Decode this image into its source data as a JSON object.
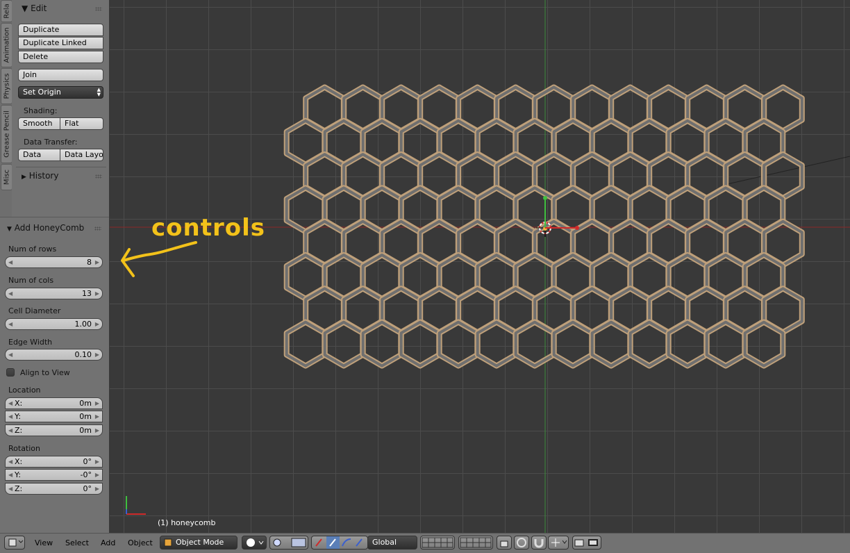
{
  "tabs": [
    "Rela",
    "Animation",
    "Physics",
    "Grease Pencil",
    "Misc"
  ],
  "edit_panel": {
    "title": "Edit",
    "buttons": [
      "Duplicate",
      "Duplicate Linked",
      "Delete"
    ],
    "join_label": "Join",
    "set_origin_label": "Set Origin",
    "shading_label": "Shading:",
    "shading_options": [
      "Smooth",
      "Flat"
    ],
    "data_transfer_label": "Data Transfer:",
    "data_transfer_options": [
      "Data",
      "Data Layo"
    ]
  },
  "history_panel": {
    "title": "History"
  },
  "operator_panel": {
    "title": "Add HoneyComb",
    "fields": [
      {
        "label": "Num of rows",
        "value": "8"
      },
      {
        "label": "Num of cols",
        "value": "13"
      },
      {
        "label": "Cell Diameter",
        "value": "1.00"
      },
      {
        "label": "Edge Width",
        "value": "0.10"
      }
    ],
    "align_to_view": {
      "label": "Align to View",
      "checked": false
    },
    "location": {
      "label": "Location",
      "x": "0m",
      "y": "0m",
      "z": "0m"
    },
    "rotation": {
      "label": "Rotation",
      "x": "0°",
      "y": "-0°",
      "z": "0°"
    },
    "axis_labels": {
      "x": "X:",
      "y": "Y:",
      "z": "Z:"
    }
  },
  "annotation": {
    "text": "controls",
    "color": "#f3c21a"
  },
  "viewport": {
    "object_label": "(1) honeycomb",
    "honeycomb_rows": 8,
    "honeycomb_cols": 13,
    "edge_color": "#bfa07a",
    "x_axis_color": "#9a2a2a",
    "y_axis_color": "#3f9a3f"
  },
  "footer": {
    "menus": [
      "View",
      "Select",
      "Add",
      "Object"
    ],
    "mode": "Object Mode",
    "orientation": "Global"
  }
}
